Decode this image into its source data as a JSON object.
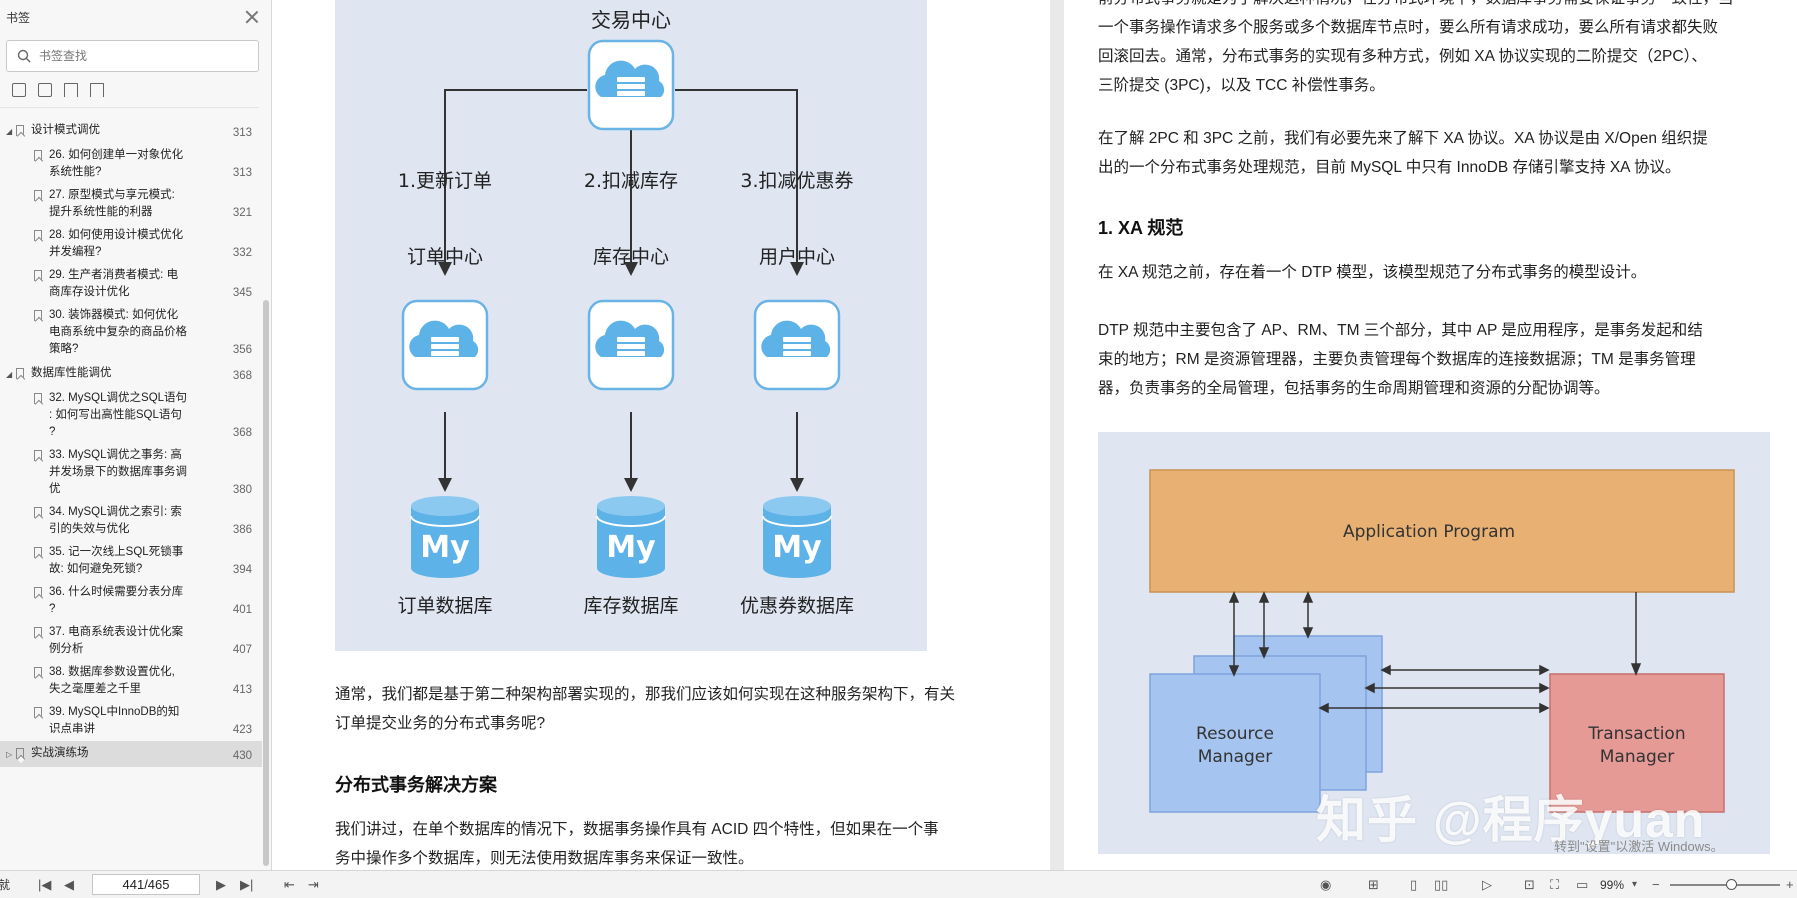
{
  "sidebar": {
    "title": "书签",
    "search_placeholder": "书签查找",
    "items": [
      {
        "label": "设计模式调优",
        "page": "313",
        "level": 1,
        "expanded": true
      },
      {
        "label": "26. 如何创建单一对象优化\n系统性能?",
        "page": "313",
        "level": 2
      },
      {
        "label": "27. 原型模式与享元模式:\n提升系统性能的利器",
        "page": "321",
        "level": 2
      },
      {
        "label": "28. 如何使用设计模式优化\n并发编程?",
        "page": "332",
        "level": 2
      },
      {
        "label": "29. 生产者消费者模式: 电\n商库存设计优化",
        "page": "345",
        "level": 2
      },
      {
        "label": "30. 装饰器模式: 如何优化\n电商系统中复杂的商品价格\n策略?",
        "page": "356",
        "level": 2
      },
      {
        "label": "数据库性能调优",
        "page": "368",
        "level": 1,
        "expanded": true
      },
      {
        "label": "32. MySQL调优之SQL语句\n: 如何写出高性能SQL语句\n?",
        "page": "368",
        "level": 2
      },
      {
        "label": "33. MySQL调优之事务: 高\n并发场景下的数据库事务调\n优",
        "page": "380",
        "level": 2
      },
      {
        "label": "34. MySQL调优之索引: 索\n引的失效与优化",
        "page": "386",
        "level": 2
      },
      {
        "label": "35. 记一次线上SQL死锁事\n故: 如何避免死锁?",
        "page": "394",
        "level": 2
      },
      {
        "label": "36. 什么时候需要分表分库\n?",
        "page": "401",
        "level": 2
      },
      {
        "label": "37. 电商系统表设计优化案\n例分析",
        "page": "407",
        "level": 2
      },
      {
        "label": "38. 数据库参数设置优化,\n失之毫厘差之千里",
        "page": "413",
        "level": 2
      },
      {
        "label": "39. MySQL中InnoDB的知\n识点串讲",
        "page": "423",
        "level": 2
      },
      {
        "label": "实战演练场",
        "page": "430",
        "level": 1,
        "expanded": false,
        "selected": true
      }
    ]
  },
  "diagram1": {
    "top_label": "交易中心",
    "edges": [
      "1.更新订单",
      "2.扣减库存",
      "3.扣减优惠券"
    ],
    "centers": [
      "订单中心",
      "库存中心",
      "用户中心"
    ],
    "databases": [
      "订单数据库",
      "库存数据库",
      "优惠券数据库"
    ],
    "db_logo": "My"
  },
  "page1": {
    "para1_line1": "通常，我们都是基于第二种架构部署实现的，那我们应该如何实现在这种服务架构下，有关",
    "para1_line2": "订单提交业务的分布式事务呢?",
    "heading": "分布式事务解决方案",
    "para2_line1": "我们讲过，在单个数据库的情况下，数据事务操作具有 ACID 四个特性，但如果在一个事",
    "para2_line2": "务中操作多个数据库，则无法使用数据库事务来保证一致性。"
  },
  "page2": {
    "p1_line0": "前分布式事务就是为了解决这种情况，在分布式环境下，数据库事务需要保证事务一致性，当",
    "p1_line1": "一个事务操作请求多个服务或多个数据库节点时，要么所有请求成功，要么所有请求都失败",
    "p1_line2": "回滚回去。通常，分布式事务的实现有多种方式，例如 XA 协议实现的二阶提交（2PC）、",
    "p1_line3": "三阶提交 (3PC)，以及 TCC 补偿性事务。",
    "p2_line1": "在了解 2PC 和 3PC 之前，我们有必要先来了解下 XA 协议。XA 协议是由 X/Open 组织提",
    "p2_line2": "出的一个分布式事务处理规范，目前 MySQL 中只有 InnoDB 存储引擎支持 XA 协议。",
    "heading": "1. XA 规范",
    "p3": "在 XA 规范之前，存在着一个 DTP 模型，该模型规范了分布式事务的模型设计。",
    "p4_line1": "DTP 规范中主要包含了 AP、RM、TM 三个部分，其中 AP 是应用程序，是事务发起和结",
    "p4_line2": "束的地方；RM 是资源管理器，主要负责管理每个数据库的连接数据源；TM 是事务管理",
    "p4_line3": "器，负责事务的全局管理，包括事务的生命周期管理和资源的分配协调等。"
  },
  "diagram2": {
    "app_label": "Application Program",
    "rm_label_1": "Resource",
    "rm_label_2": "Manager",
    "tm_label_1": "Transaction",
    "tm_label_2": "Manager",
    "app_color": "#e8b173",
    "rm_color": "#a6c4f0",
    "tm_color": "#e59a96"
  },
  "watermark": {
    "text": "知乎 @程序yuan",
    "windows_text": "转到\"设置\"以激活 Windows。"
  },
  "statusbar": {
    "left_char": "就",
    "page_display": "441/465",
    "zoom": "99%",
    "zoom_fraction": 0.55
  }
}
